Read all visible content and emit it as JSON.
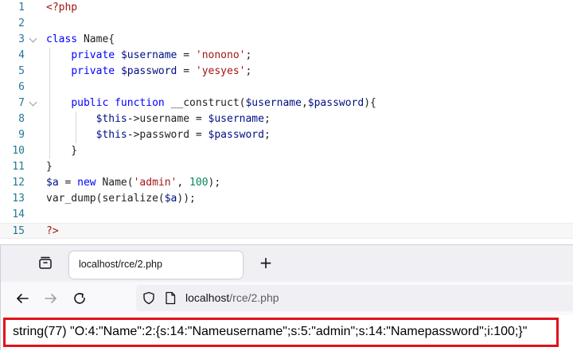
{
  "editor": {
    "lines": [
      {
        "n": "1",
        "tokens": [
          {
            "t": "<?php",
            "c": "t-tag"
          }
        ]
      },
      {
        "n": "2",
        "tokens": []
      },
      {
        "n": "3",
        "tokens": [
          {
            "t": "class",
            "c": "t-kw"
          },
          {
            "t": " Name{",
            "c": "t-pl"
          }
        ]
      },
      {
        "n": "4",
        "tokens": [
          {
            "t": "    ",
            "c": "t-pl"
          },
          {
            "t": "private",
            "c": "t-kw"
          },
          {
            "t": " ",
            "c": "t-pl"
          },
          {
            "t": "$username",
            "c": "t-var"
          },
          {
            "t": " = ",
            "c": "t-pl"
          },
          {
            "t": "'nonono'",
            "c": "t-str"
          },
          {
            "t": ";",
            "c": "t-pl"
          }
        ]
      },
      {
        "n": "5",
        "tokens": [
          {
            "t": "    ",
            "c": "t-pl"
          },
          {
            "t": "private",
            "c": "t-kw"
          },
          {
            "t": " ",
            "c": "t-pl"
          },
          {
            "t": "$password",
            "c": "t-var"
          },
          {
            "t": " = ",
            "c": "t-pl"
          },
          {
            "t": "'yesyes'",
            "c": "t-str"
          },
          {
            "t": ";",
            "c": "t-pl"
          }
        ]
      },
      {
        "n": "6",
        "tokens": []
      },
      {
        "n": "7",
        "tokens": [
          {
            "t": "    ",
            "c": "t-pl"
          },
          {
            "t": "public",
            "c": "t-kw"
          },
          {
            "t": " ",
            "c": "t-pl"
          },
          {
            "t": "function",
            "c": "t-kw"
          },
          {
            "t": " ",
            "c": "t-pl"
          },
          {
            "t": "__construct",
            "c": "t-pl"
          },
          {
            "t": "(",
            "c": "t-pl"
          },
          {
            "t": "$username",
            "c": "t-var"
          },
          {
            "t": ",",
            "c": "t-pl"
          },
          {
            "t": "$password",
            "c": "t-var"
          },
          {
            "t": "){",
            "c": "t-pl"
          }
        ]
      },
      {
        "n": "8",
        "tokens": [
          {
            "t": "        ",
            "c": "t-pl"
          },
          {
            "t": "$this",
            "c": "t-var"
          },
          {
            "t": "->username = ",
            "c": "t-pl"
          },
          {
            "t": "$username",
            "c": "t-var"
          },
          {
            "t": ";",
            "c": "t-pl"
          }
        ]
      },
      {
        "n": "9",
        "tokens": [
          {
            "t": "        ",
            "c": "t-pl"
          },
          {
            "t": "$this",
            "c": "t-var"
          },
          {
            "t": "->password = ",
            "c": "t-pl"
          },
          {
            "t": "$password",
            "c": "t-var"
          },
          {
            "t": ";",
            "c": "t-pl"
          }
        ]
      },
      {
        "n": "10",
        "tokens": [
          {
            "t": "    }",
            "c": "t-pl"
          }
        ]
      },
      {
        "n": "11",
        "tokens": [
          {
            "t": "}",
            "c": "t-pl"
          }
        ]
      },
      {
        "n": "12",
        "tokens": [
          {
            "t": "$a",
            "c": "t-var"
          },
          {
            "t": " = ",
            "c": "t-pl"
          },
          {
            "t": "new",
            "c": "t-kw"
          },
          {
            "t": " Name(",
            "c": "t-pl"
          },
          {
            "t": "'admin'",
            "c": "t-str"
          },
          {
            "t": ", ",
            "c": "t-pl"
          },
          {
            "t": "100",
            "c": "t-num"
          },
          {
            "t": ");",
            "c": "t-pl"
          }
        ]
      },
      {
        "n": "13",
        "tokens": [
          {
            "t": "var_dump",
            "c": "t-pl"
          },
          {
            "t": "(",
            "c": "t-pl"
          },
          {
            "t": "serialize",
            "c": "t-pl"
          },
          {
            "t": "(",
            "c": "t-pl"
          },
          {
            "t": "$a",
            "c": "t-var"
          },
          {
            "t": "));",
            "c": "t-pl"
          }
        ]
      },
      {
        "n": "14",
        "tokens": []
      },
      {
        "n": "15",
        "tokens": [
          {
            "t": "?>",
            "c": "t-tag"
          }
        ]
      }
    ],
    "fold_lines": [
      "3",
      "7"
    ],
    "active_line": "15"
  },
  "browser": {
    "tab_title": "localhost/rce/2.php",
    "new_tab_label": "+",
    "url_host": "localhost",
    "url_path": "/rce/2.php",
    "page_output": "string(77) \"O:4:\"Name\":2:{s:14:\"Nameusername\";s:5:\"admin\";s:14:\"Namepassword\";i:100;}\"",
    "highlight_color": "#e0121b"
  }
}
